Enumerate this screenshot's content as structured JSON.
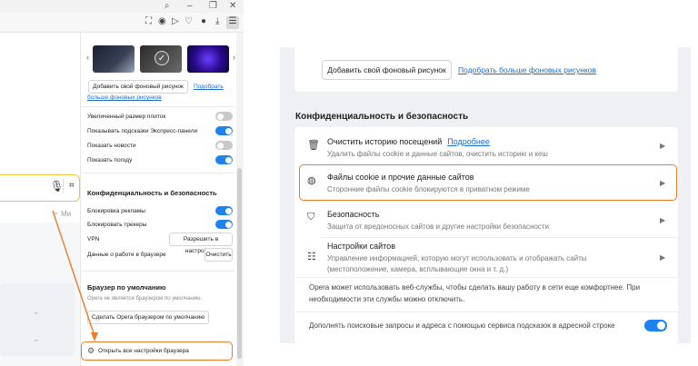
{
  "left": {
    "topbar_icons": [
      "search-icon",
      "minimize-icon",
      "restore-icon",
      "close-icon"
    ],
    "toolbar_icons": [
      "snapshot-icon",
      "camera-icon",
      "play-icon",
      "heart-icon",
      "profile-icon",
      "download-icon",
      "easy-setup-icon"
    ],
    "mini_text": "Ми",
    "bg": {
      "add_button": "Добавить свой фоновый рисунок",
      "more_link_line1": "Подобрать",
      "more_link_line2": "больше фоновых рисунков"
    },
    "toggles": [
      {
        "label": "Увеличенный размер плиток",
        "on": false
      },
      {
        "label": "Показывать подсказки Экспресс-панели",
        "on": true
      },
      {
        "label": "Показать новости",
        "on": false
      },
      {
        "label": "Показать погоду",
        "on": true
      }
    ],
    "privacy": {
      "title": "Конфиденциальность и безопасность",
      "ad_block": "Блокировка рекламы",
      "trackers": "Блокировать трекеры",
      "vpn": "VPN",
      "vpn_button": "Разрешить в настройках",
      "data": "Данные о работе в браузере",
      "clear_button": "Очистить"
    },
    "default_browser": {
      "title": "Браузер по умолчанию",
      "subtitle": "Opera не является браузером по умолчанию.",
      "button": "Сделать Opera браузером по умолчанию"
    },
    "open_settings": "Открыть все настройки браузера"
  },
  "right": {
    "bg_button": "Добавить свой фоновый рисунок",
    "bg_link": "Подобрать больше фоновых рисунков",
    "section_title": "Конфиденциальность и безопасность",
    "items": [
      {
        "title": "Очистить историю посещений",
        "link": "Подробнее",
        "sub": "Удалить файлы cookie и данные сайтов, очистить историю и кеш",
        "icon": "trash-icon"
      },
      {
        "title": "Файлы cookie и прочие данные сайтов",
        "sub": "Сторонние файлы cookie блокируются в приватном режиме",
        "icon": "cookie-icon"
      },
      {
        "title": "Безопасность",
        "sub": "Защита от вредоносных сайтов и другие настройки безопасности",
        "icon": "shield-icon"
      },
      {
        "title": "Настройки сайтов",
        "sub1": "Управление информацией, которую могут использовать и отображать сайты",
        "sub2": "(местоположение, камера, всплывающие окна и т. д.)",
        "icon": "sliders-icon"
      }
    ],
    "web_services_line1": "Opera может использовать веб-службы, чтобы сделать вашу работу в сети еще комфортнее. При",
    "web_services_line2": "необходимости эти службы можно отключить.",
    "suggest": "Дополнять поисковые запросы и адреса с помощью сервиса подсказок в адресной строке",
    "suggest_on": true
  }
}
